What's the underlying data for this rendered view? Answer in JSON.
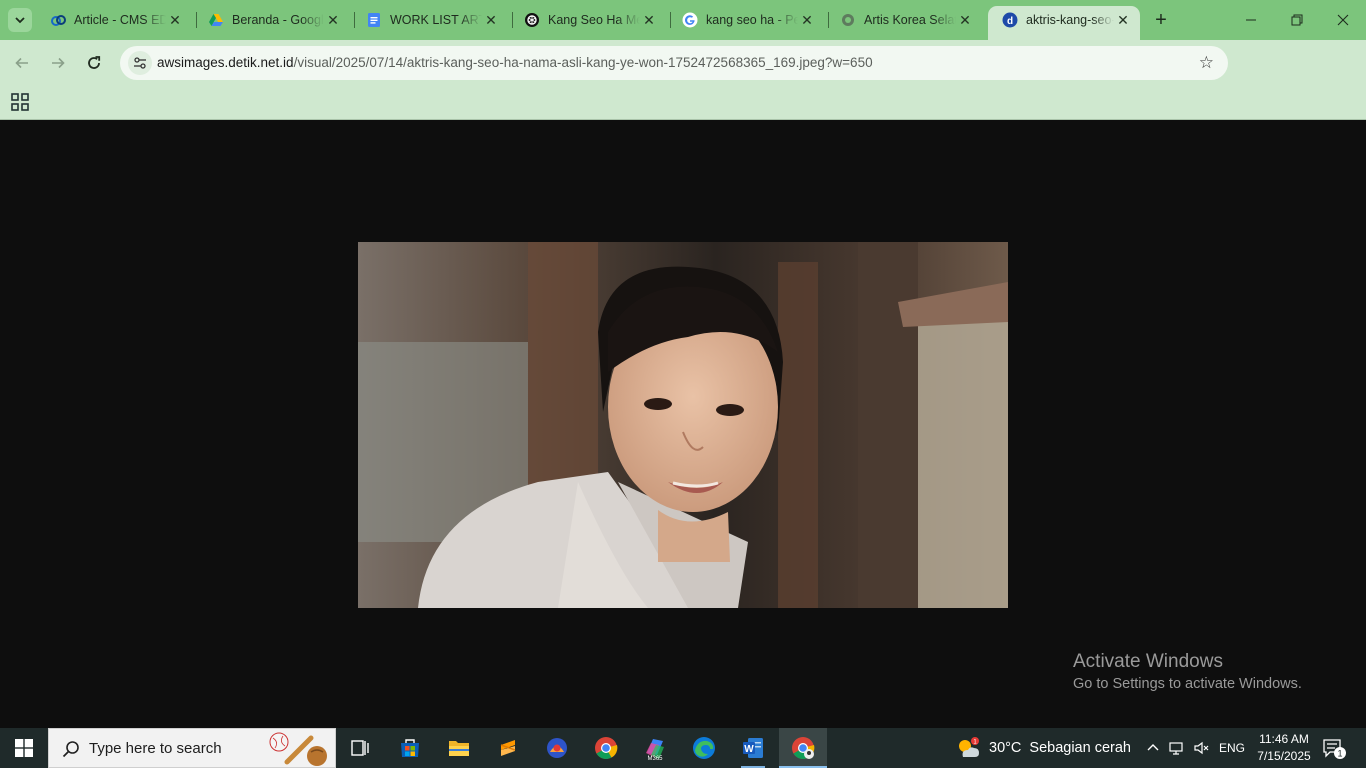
{
  "tabs": [
    {
      "title": "Article - CMS EDITOR",
      "icon": "cms-icon"
    },
    {
      "title": "Beranda - Google Drive",
      "icon": "google-drive-icon"
    },
    {
      "title": "WORK LIST ARTIKEL",
      "icon": "google-docs-icon"
    },
    {
      "title": "Kang Seo Ha Meninggal",
      "icon": "chatgpt-icon"
    },
    {
      "title": "kang seo ha - Penelusuran Google",
      "icon": "google-icon"
    },
    {
      "title": "Artis Korea Selatan",
      "icon": "web-icon"
    },
    {
      "title": "aktris-kang-seo-ha-nama-asli",
      "icon": "detik-icon"
    }
  ],
  "active_tab": 6,
  "address": {
    "host": "awsimages.detik.net.id",
    "path": "/visual/2025/07/14/aktris-kang-seo-ha-nama-asli-kang-ye-won-1752472568365_169.jpeg?w=650"
  },
  "watermark": {
    "line1": "Activate Windows",
    "line2": "Go to Settings to activate Windows."
  },
  "taskbar": {
    "search_placeholder": "Type here to search",
    "apps": [
      "task-view",
      "microsoft-store",
      "file-explorer",
      "sublime-text",
      "ubuntu-app",
      "chrome",
      "microsoft-365",
      "edge",
      "word",
      "chrome-profile"
    ],
    "weather_temp": "30°C",
    "weather_desc": "Sebagian cerah",
    "language": "ENG",
    "time": "11:46 AM",
    "date": "7/15/2025",
    "notifications": "1"
  },
  "colors": {
    "tabstrip": "#7cc57c",
    "toolbar": "#cfe8cf",
    "viewer_bg": "#0e0e0e",
    "taskbar": "#1f2a2a"
  }
}
